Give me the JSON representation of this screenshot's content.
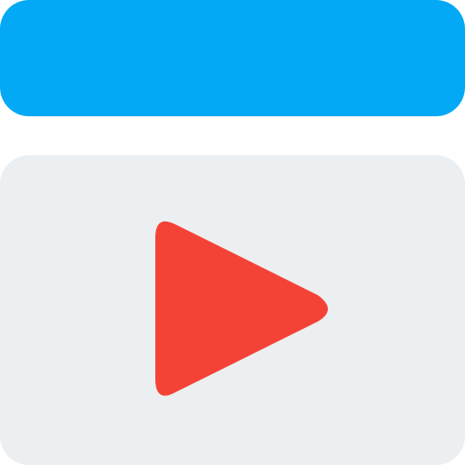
{
  "colors": {
    "top_bar": "#03A9F4",
    "video_panel": "#ECEFF1",
    "play_button": "#F44336"
  },
  "icons": {
    "top_bar": "clapperboard-top-bar",
    "video_panel": "video-frame",
    "play": "play-icon"
  }
}
